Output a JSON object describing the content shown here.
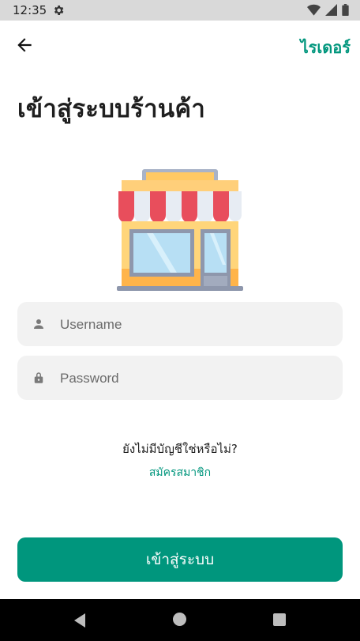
{
  "status_bar": {
    "time": "12:35",
    "icons": [
      "gear-icon",
      "wifi-icon",
      "signal-icon",
      "battery-icon"
    ]
  },
  "app_bar": {
    "back_icon": "arrow-left-icon",
    "rider_label": "ไรเดอร์"
  },
  "title": "เข้าสู่ระบบร้านค้า",
  "illustration": "shop-storefront",
  "form": {
    "username_placeholder": "Username",
    "username_value": "",
    "password_placeholder": "Password",
    "password_value": ""
  },
  "signup": {
    "prompt": "ยังไม่มีบัญชีใช่หรือไม่?",
    "link_label": "สมัครสมาชิก"
  },
  "login_button": "เข้าสู่ระบบ",
  "colors": {
    "primary": "#00967d",
    "status_bar": "#d9d9d9",
    "input_bg": "#f2f2f2",
    "nav_bar": "#000000"
  }
}
